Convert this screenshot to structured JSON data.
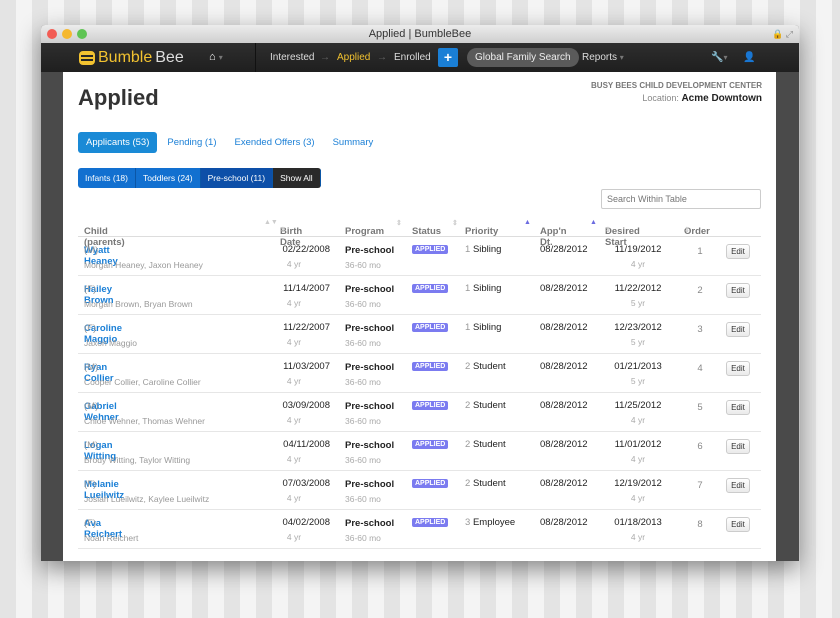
{
  "window": {
    "title": "Applied | BumbleBee"
  },
  "nav": {
    "brand_a": "Bumble",
    "brand_b": "Bee",
    "links": [
      "Interested",
      "Applied",
      "Enrolled"
    ],
    "active": "Applied",
    "add": "+",
    "global_search": "Global Family Search",
    "reports": "Reports"
  },
  "page": {
    "title": "Applied",
    "center": "BUSY BEES CHILD DEVELOPMENT CENTER",
    "location_label": "Location:",
    "location": "Acme Downtown"
  },
  "tabs": [
    "Applicants (53)",
    "Pending (1)",
    "Exended Offers (3)",
    "Summary"
  ],
  "filters": [
    "Infants (18)",
    "Toddlers (24)",
    "Pre-school (11)",
    "Show All"
  ],
  "search": {
    "placeholder": "Search Within Table"
  },
  "columns": [
    "Child (parents)",
    "Birth Date",
    "Program",
    "Status",
    "Priority",
    "App'n Dt.",
    "Desired Start",
    "Order"
  ],
  "colors": {
    "accent": "#1a7fd6",
    "brand": "#f2c230",
    "status": "#7b7bf0"
  },
  "rows": [
    {
      "name": "Wyatt Heaney",
      "g": "(M)",
      "parents": "Morgan Heaney, Jaxon Heaney",
      "birth": "02/22/2008",
      "age": "4 yr",
      "program": "Pre-school",
      "range": "36-60 mo",
      "status": "APPLIED",
      "pn": "1",
      "priority": "Sibling",
      "app": "08/28/2012",
      "start": "11/19/2012",
      "start_age": "4 yr",
      "order": "1",
      "edit": "Edit"
    },
    {
      "name": "Hailey Brown",
      "g": "(F)",
      "parents": "Morgan Brown, Bryan Brown",
      "birth": "11/14/2007",
      "age": "4 yr",
      "program": "Pre-school",
      "range": "36-60 mo",
      "status": "APPLIED",
      "pn": "1",
      "priority": "Sibling",
      "app": "08/28/2012",
      "start": "11/22/2012",
      "start_age": "5 yr",
      "order": "2",
      "edit": "Edit"
    },
    {
      "name": "Caroline Maggio",
      "g": "(F)",
      "parents": "Jaxon Maggio",
      "birth": "11/22/2007",
      "age": "4 yr",
      "program": "Pre-school",
      "range": "36-60 mo",
      "status": "APPLIED",
      "pn": "1",
      "priority": "Sibling",
      "app": "08/28/2012",
      "start": "12/23/2012",
      "start_age": "5 yr",
      "order": "3",
      "edit": "Edit"
    },
    {
      "name": "Ryan Collier",
      "g": "(M)",
      "parents": "Cooper Collier, Caroline Collier",
      "birth": "11/03/2007",
      "age": "4 yr",
      "program": "Pre-school",
      "range": "36-60 mo",
      "status": "APPLIED",
      "pn": "2",
      "priority": "Student",
      "app": "08/28/2012",
      "start": "01/21/2013",
      "start_age": "5 yr",
      "order": "4",
      "edit": "Edit"
    },
    {
      "name": "Gabriel Wehner",
      "g": "(M)",
      "parents": "Chloe Wehner, Thomas Wehner",
      "birth": "03/09/2008",
      "age": "4 yr",
      "program": "Pre-school",
      "range": "36-60 mo",
      "status": "APPLIED",
      "pn": "2",
      "priority": "Student",
      "app": "08/28/2012",
      "start": "11/25/2012",
      "start_age": "4 yr",
      "order": "5",
      "edit": "Edit"
    },
    {
      "name": "Logan Witting",
      "g": "(M)",
      "parents": "Brody Witting, Taylor Witting",
      "birth": "04/11/2008",
      "age": "4 yr",
      "program": "Pre-school",
      "range": "36-60 mo",
      "status": "APPLIED",
      "pn": "2",
      "priority": "Student",
      "app": "08/28/2012",
      "start": "11/01/2012",
      "start_age": "4 yr",
      "order": "6",
      "edit": "Edit"
    },
    {
      "name": "Melanie Lueilwitz",
      "g": "(F)",
      "parents": "Josiah Lueilwitz, Kaylee Lueilwitz",
      "birth": "07/03/2008",
      "age": "4 yr",
      "program": "Pre-school",
      "range": "36-60 mo",
      "status": "APPLIED",
      "pn": "2",
      "priority": "Student",
      "app": "08/28/2012",
      "start": "12/19/2012",
      "start_age": "4 yr",
      "order": "7",
      "edit": "Edit"
    },
    {
      "name": "Ava Reichert",
      "g": "(F)",
      "parents": "Noah Reichert",
      "birth": "04/02/2008",
      "age": "4 yr",
      "program": "Pre-school",
      "range": "36-60 mo",
      "status": "APPLIED",
      "pn": "3",
      "priority": "Employee",
      "app": "08/28/2012",
      "start": "01/18/2013",
      "start_age": "4 yr",
      "order": "8",
      "edit": "Edit"
    }
  ]
}
